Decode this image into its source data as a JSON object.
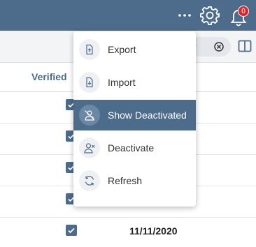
{
  "topbar": {
    "more_icon": "ellipsis-icon",
    "settings_icon": "gear-icon",
    "notifications_icon": "bell-icon",
    "notification_count": "0"
  },
  "toolbar": {
    "search_tail": "r",
    "clear_icon": "close-circle-icon",
    "columns_icon": "columns-icon"
  },
  "table": {
    "verified_header": "Verified",
    "last_row_date": "11/11/2020"
  },
  "menu": {
    "items": [
      {
        "label": "Export",
        "icon": "export-file-icon",
        "active": false
      },
      {
        "label": "Import",
        "icon": "import-file-icon",
        "active": false
      },
      {
        "label": "Show Deactivated",
        "icon": "user-hidden-icon",
        "active": true
      },
      {
        "label": "Deactivate",
        "icon": "user-remove-icon",
        "active": false
      },
      {
        "label": "Refresh",
        "icon": "refresh-icon",
        "active": false
      }
    ]
  },
  "colors": {
    "brand": "#4d6b8a",
    "badge": "#e0242a"
  }
}
